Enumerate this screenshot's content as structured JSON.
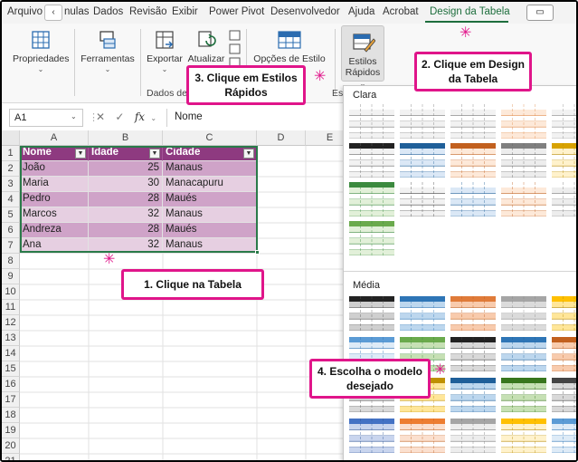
{
  "tabs": [
    {
      "label": "Arquivo",
      "active": false
    },
    {
      "label": "nulas",
      "active": false
    },
    {
      "label": "Dados",
      "active": false
    },
    {
      "label": "Revisão",
      "active": false
    },
    {
      "label": "Exibir",
      "active": false
    },
    {
      "label": "Power Pivot",
      "active": false
    },
    {
      "label": "Desenvolvedor",
      "active": false
    },
    {
      "label": "Ajuda",
      "active": false
    },
    {
      "label": "Acrobat",
      "active": false
    },
    {
      "label": "Design da Tabela",
      "active": true
    }
  ],
  "ribbon": {
    "propriedades": "Propriedades",
    "ferramentas": "Ferramentas",
    "exportar": "Exportar",
    "atualizar": "Atualizar",
    "opcoes_estilo": "Opções de Estilo",
    "estilos_line1": "Estilos",
    "estilos_line2": "Rápidos",
    "group_dados": "Dados de",
    "group_estilo": "Est"
  },
  "formula_bar": {
    "name_box": "A1",
    "fx": "fx",
    "value": "Nome"
  },
  "grid": {
    "columns": [
      "A",
      "B",
      "C",
      "D",
      "E"
    ],
    "rows": [
      "1",
      "2",
      "3",
      "4",
      "5",
      "6",
      "7",
      "8",
      "9",
      "10",
      "11",
      "12",
      "13",
      "14",
      "15",
      "16",
      "17",
      "18",
      "19",
      "20",
      "21"
    ],
    "table_headers": [
      "Nome",
      "Idade",
      "Cidade"
    ],
    "table_rows": [
      [
        "João",
        "25",
        "Manaus"
      ],
      [
        "Maria",
        "30",
        "Manacapuru"
      ],
      [
        "Pedro",
        "28",
        "Maués"
      ],
      [
        "Marcos",
        "32",
        "Manaus"
      ],
      [
        "Andreza",
        "28",
        "Maués"
      ],
      [
        "Ana",
        "32",
        "Manaus"
      ]
    ]
  },
  "gallery": {
    "section_light": "Clara",
    "section_medium": "Média"
  },
  "callouts": {
    "step1": "1. Clique na Tabela",
    "step2_line1": "2. Clique em Design",
    "step2_line2": "da Tabela",
    "step3_line1": "3. Clique em Estilos",
    "step3_line2": "Rápidos",
    "step4_line1": "4. Escolha o modelo",
    "step4_line2": "desejado"
  },
  "colors": {
    "accent_green": "#1e6e3d",
    "table_header": "#8e3a80",
    "table_band_dark": "#cfa3c8",
    "table_band_light": "#e6cfe1",
    "callout_border": "#e0158a"
  }
}
